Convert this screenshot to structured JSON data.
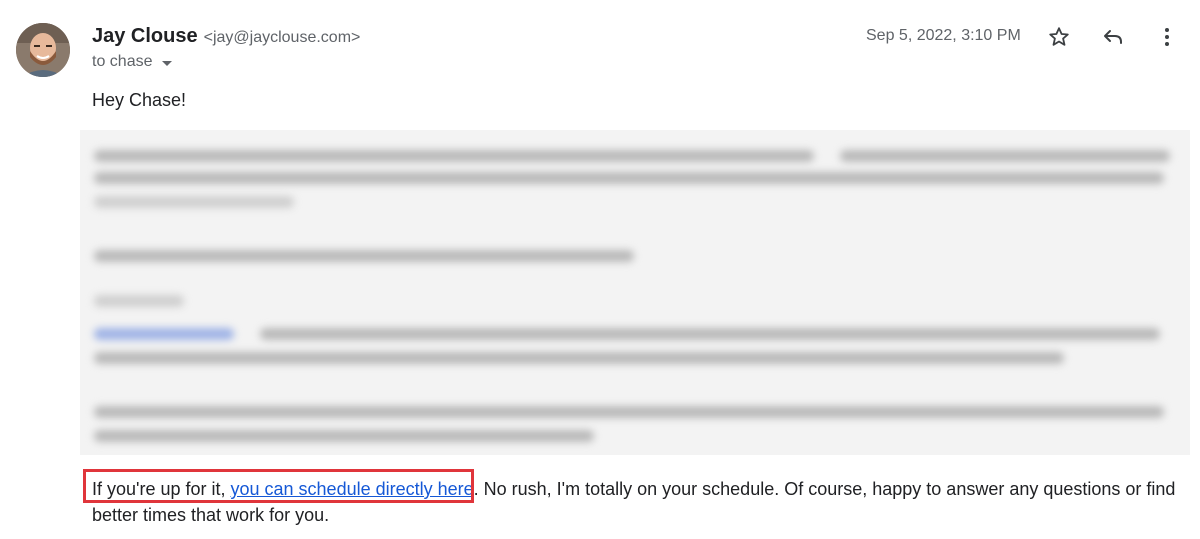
{
  "sender": {
    "name": "Jay Clouse",
    "email": "<jay@jayclouse.com>"
  },
  "recipient": {
    "label": "to chase"
  },
  "date": "Sep 5, 2022, 3:10 PM",
  "icons": {
    "star": "star-icon",
    "reply": "reply-icon",
    "more": "more-vert-icon"
  },
  "body": {
    "greeting": "Hey Chase!",
    "paragraph": {
      "prefix": "If you're up for it, ",
      "link_text": "you can schedule directly here",
      "suffix": ". No rush, I'm totally on your schedule. Of course, happy to answer any questions or find better times that work for you."
    }
  },
  "colors": {
    "highlight_border": "#e0353b",
    "link": "#1558d6"
  }
}
